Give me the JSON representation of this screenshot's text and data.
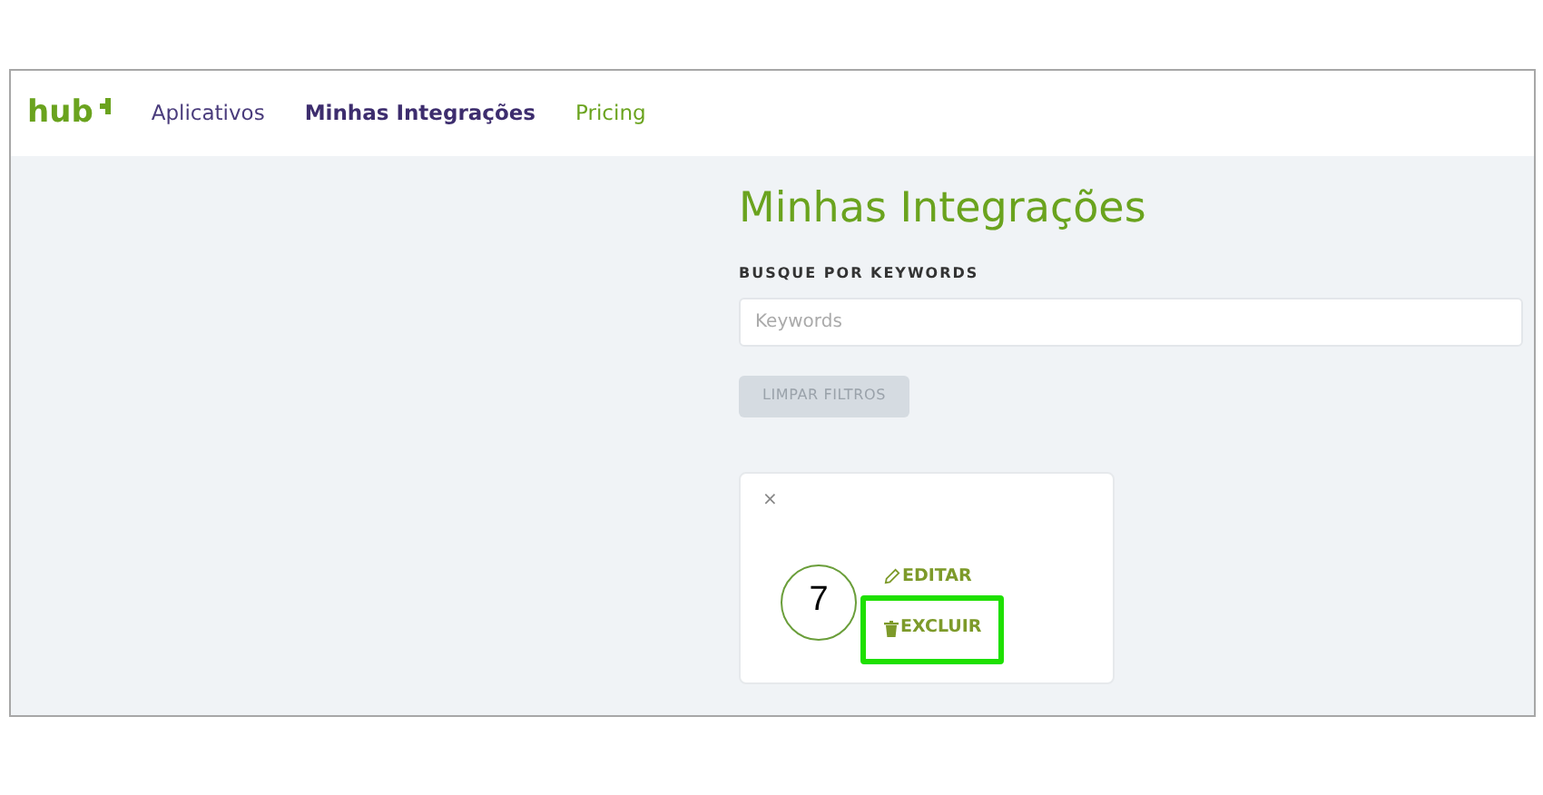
{
  "navbar": {
    "logo": "hub",
    "links": [
      {
        "label": "Aplicativos",
        "selected": false
      },
      {
        "label": "Minhas Integrações",
        "selected": true
      },
      {
        "label": "Pricing",
        "selected": false,
        "kind": "accent"
      }
    ]
  },
  "page": {
    "title": "Minhas Integrações",
    "search_label": "BUSQUE POR KEYWORDS",
    "search": {
      "placeholder": "Keywords"
    },
    "clear_button": {
      "label": "LIMPAR FILTROS",
      "disabled": true
    }
  },
  "card": {
    "close": "×",
    "actions": [
      {
        "label": "EDITAR",
        "kind": "edit",
        "highlighted": false
      },
      {
        "label": "EXCLUIR",
        "kind": "delete",
        "highlighted": true
      }
    ]
  },
  "annotation": {
    "step": "7"
  }
}
